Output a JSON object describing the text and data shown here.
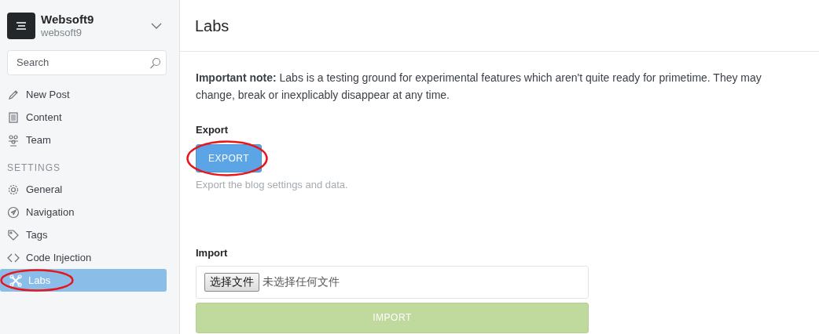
{
  "sidebar": {
    "blog_title": "Websoft9",
    "blog_subtitle": "websoft9",
    "search": {
      "placeholder": "Search"
    },
    "items": [
      {
        "label": "New Post",
        "selected": false,
        "circled": false
      },
      {
        "label": "Content",
        "selected": false,
        "circled": false
      },
      {
        "label": "Team",
        "selected": false,
        "circled": false
      }
    ],
    "settings_heading": "SETTINGS",
    "settings_items": [
      {
        "label": "General",
        "selected": false,
        "circled": false
      },
      {
        "label": "Navigation",
        "selected": false,
        "circled": false
      },
      {
        "label": "Tags",
        "selected": false,
        "circled": false
      },
      {
        "label": "Code Injection",
        "selected": false,
        "circled": false
      },
      {
        "label": "Labs",
        "selected": true,
        "circled": true
      }
    ]
  },
  "main": {
    "title": "Labs",
    "note": "**Important note:** Labs is a testing ground for experimental features which aren't quite ready for primetime. They may change, break or inexplicably disappear at any time.",
    "export": {
      "label": "Export",
      "button": {
        "text": "EXPORT",
        "circled": true
      },
      "help": "Export the blog settings and data."
    },
    "import": {
      "label": "Import",
      "choose_button": "选择文件",
      "file_status": "未选择任何文件",
      "button": {
        "text": "IMPORT",
        "disabled": true
      }
    }
  }
}
